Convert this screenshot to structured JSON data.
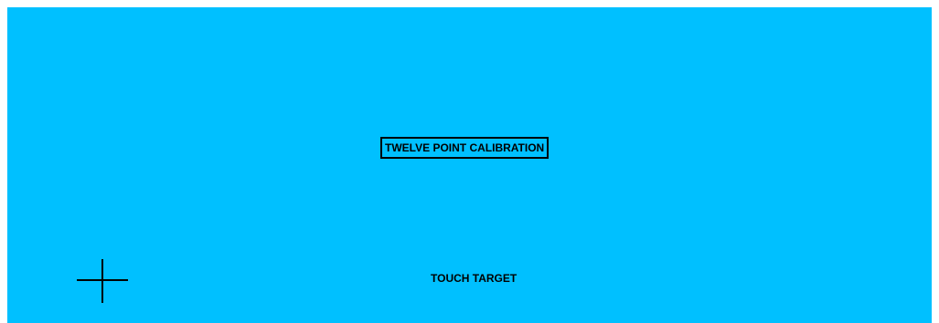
{
  "calibration": {
    "title": "TWELVE POINT CALIBRATION",
    "instruction": "TOUCH TARGET",
    "target_icon": "crosshair-icon"
  },
  "colors": {
    "background": "#00c0ff",
    "foreground": "#000000"
  }
}
